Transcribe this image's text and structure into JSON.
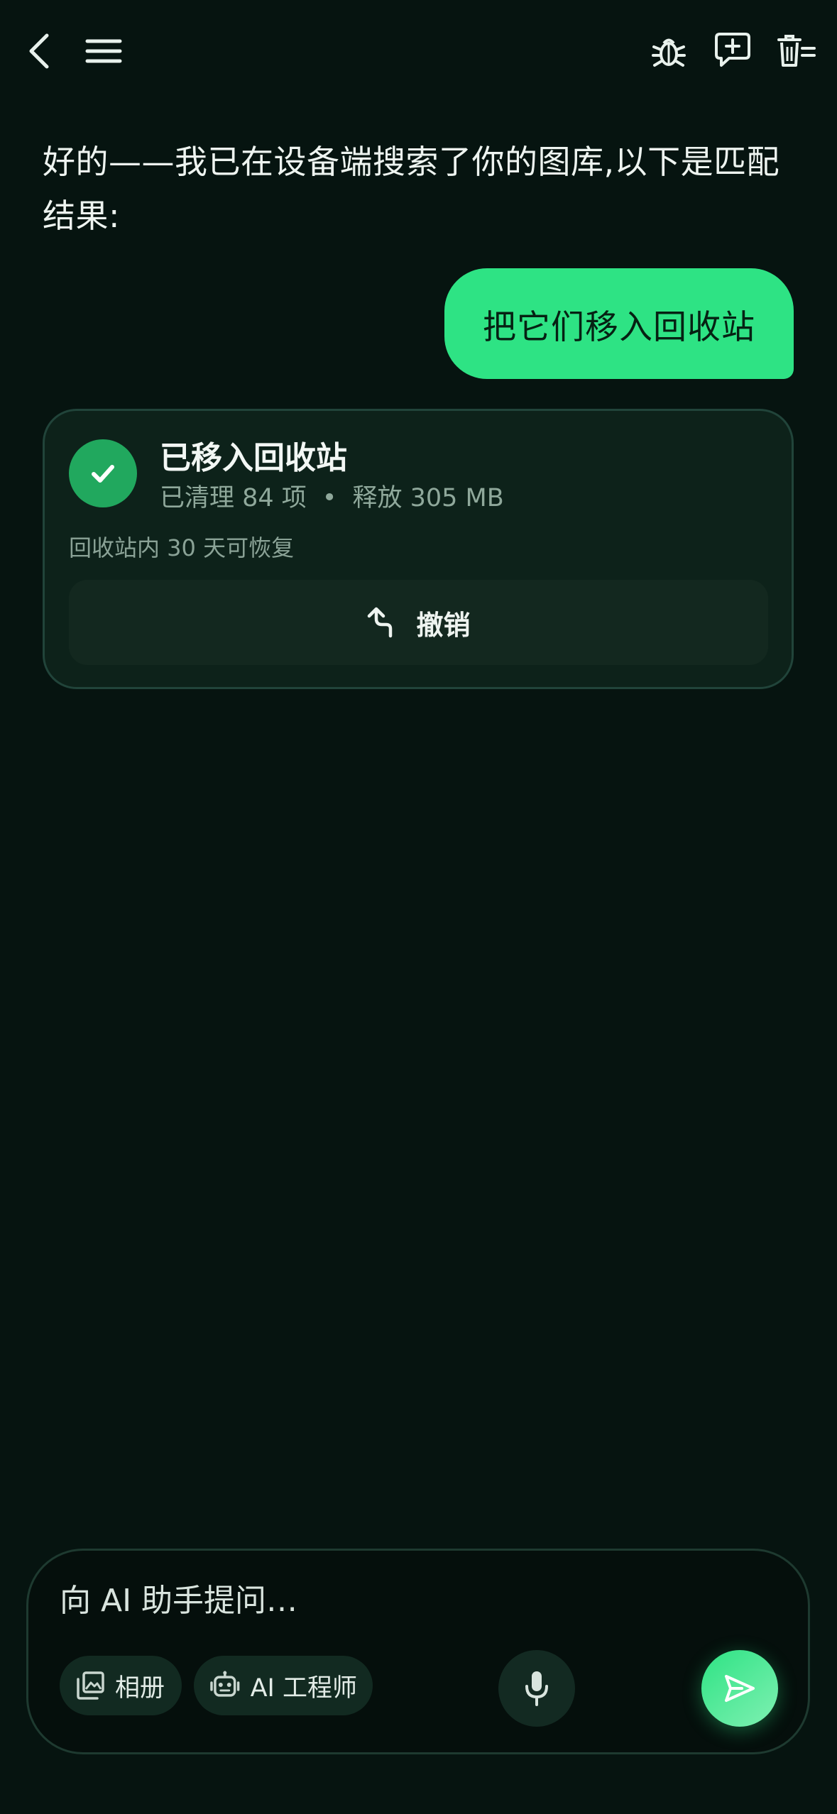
{
  "colors": {
    "background": "#061410",
    "accent": "#2ee384",
    "success": "#21a85e",
    "card_bg": "#0d221a",
    "card_border": "#21443a",
    "muted_text": "#8fa89b"
  },
  "topbar": {
    "icons": [
      "back-arrow-icon",
      "menu-icon",
      "bug-icon",
      "new-chat-icon",
      "clear-chat-icon"
    ]
  },
  "chat": {
    "assistant_message": "好的——我已在设备端搜索了你的图库,以下是匹配结果:",
    "user_message": "把它们移入回收站"
  },
  "result_card": {
    "status_icon": "check-icon",
    "title": "已移入回收站",
    "cleaned": "已清理 84 项",
    "separator": "•",
    "freed": "释放 305 MB",
    "note": "回收站内 30 天可恢复",
    "undo_icon": "undo-arrow-icon",
    "undo_label": "撤销"
  },
  "composer": {
    "placeholder": "向 AI 助手提问…",
    "value": "",
    "chips": [
      {
        "icon": "photo-library-icon",
        "label": "相册"
      },
      {
        "icon": "robot-icon",
        "label": "AI 工程师"
      }
    ],
    "mic_icon": "microphone-icon",
    "send_icon": "send-icon"
  }
}
